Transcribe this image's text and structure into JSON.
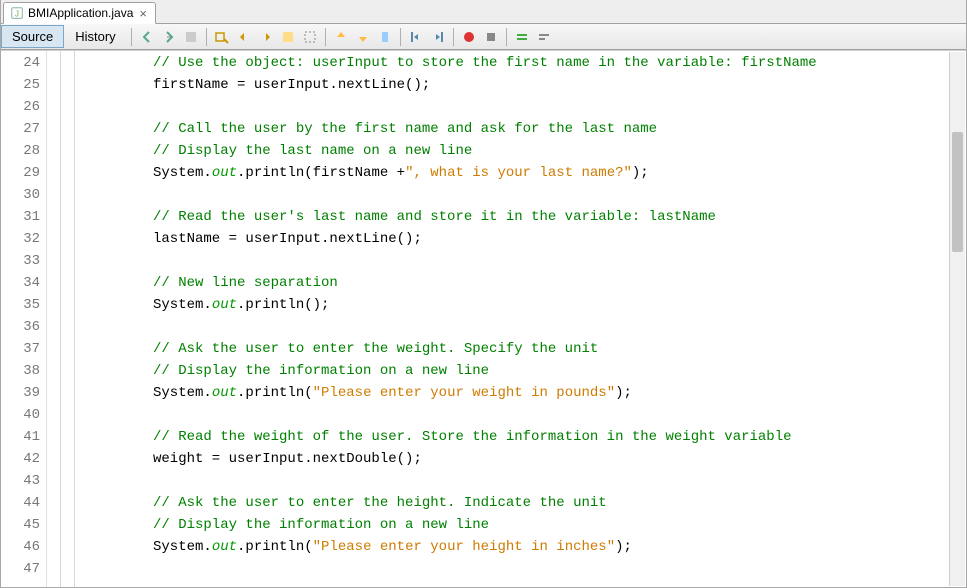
{
  "tab": {
    "filename": "BMIApplication.java",
    "close_glyph": "×"
  },
  "toolbar": {
    "source_label": "Source",
    "history_label": "History"
  },
  "gutter": {
    "start": 24,
    "end": 47
  },
  "code": {
    "lines": [
      {
        "kind": "comment",
        "text": "// Use the object: userInput to store the first name in the variable: firstName"
      },
      {
        "kind": "plain",
        "text": "firstName = userInput.nextLine();"
      },
      {
        "kind": "blank",
        "text": ""
      },
      {
        "kind": "comment",
        "text": "// Call the user by the first name and ask for the last name"
      },
      {
        "kind": "comment",
        "text": "// Display the last name on a new line"
      },
      {
        "kind": "sysout",
        "prefix": "System.",
        "field": "out",
        "mid": ".println(firstName +",
        "string": "\", what is your last name?\"",
        "suffix": ");"
      },
      {
        "kind": "blank",
        "text": ""
      },
      {
        "kind": "comment",
        "text": "// Read the user's last name and store it in the variable: lastName"
      },
      {
        "kind": "plain",
        "text": "lastName = userInput.nextLine();"
      },
      {
        "kind": "blank",
        "text": ""
      },
      {
        "kind": "comment",
        "text": "// New line separation"
      },
      {
        "kind": "sysout",
        "prefix": "System.",
        "field": "out",
        "mid": ".println();",
        "string": "",
        "suffix": ""
      },
      {
        "kind": "blank",
        "text": ""
      },
      {
        "kind": "comment",
        "text": "// Ask the user to enter the weight. Specify the unit"
      },
      {
        "kind": "comment",
        "text": "// Display the information on a new line"
      },
      {
        "kind": "sysout",
        "prefix": "System.",
        "field": "out",
        "mid": ".println(",
        "string": "\"Please enter your weight in pounds\"",
        "suffix": ");"
      },
      {
        "kind": "blank",
        "text": ""
      },
      {
        "kind": "comment",
        "text": "// Read the weight of the user. Store the information in the weight variable"
      },
      {
        "kind": "plain",
        "text": "weight = userInput.nextDouble();"
      },
      {
        "kind": "blank",
        "text": ""
      },
      {
        "kind": "comment",
        "text": "// Ask the user to enter the height. Indicate the unit"
      },
      {
        "kind": "comment",
        "text": "// Display the information on a new line"
      },
      {
        "kind": "sysout",
        "prefix": "System.",
        "field": "out",
        "mid": ".println(",
        "string": "\"Please enter your height in inches\"",
        "suffix": ");"
      },
      {
        "kind": "blank",
        "text": ""
      }
    ]
  }
}
